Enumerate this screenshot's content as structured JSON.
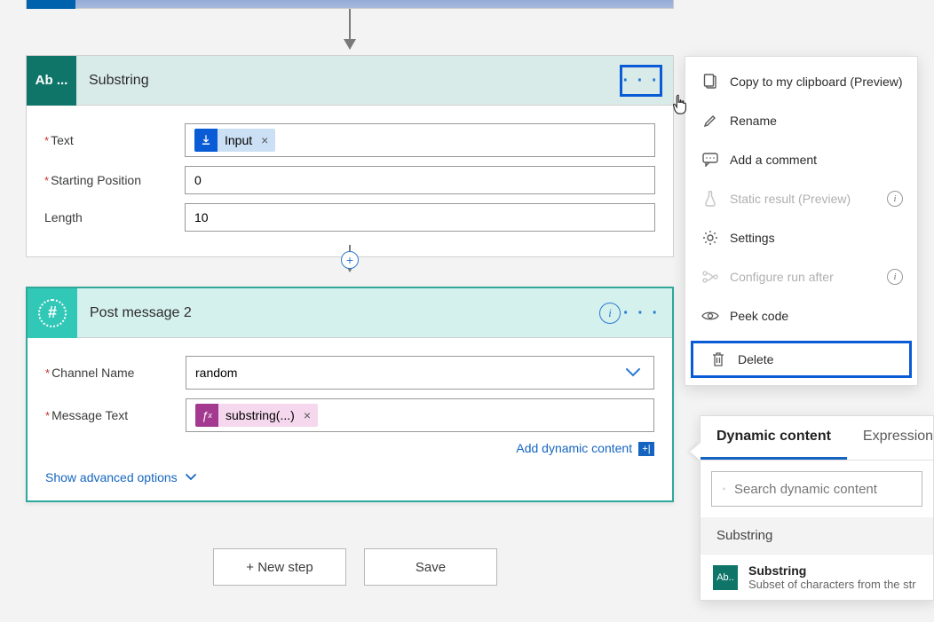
{
  "cards": {
    "substring": {
      "icon_label": "Ab ...",
      "title": "Substring",
      "fields": {
        "text_label": "Text",
        "text_token": "Input",
        "starting_position_label": "Starting Position",
        "starting_position_value": "0",
        "length_label": "Length",
        "length_value": "10"
      }
    },
    "post_message": {
      "title": "Post message 2",
      "fields": {
        "channel_label": "Channel Name",
        "channel_value": "random",
        "message_label": "Message Text",
        "message_token": "substring(...)",
        "add_dynamic_link": "Add dynamic content",
        "show_advanced": "Show advanced options"
      }
    }
  },
  "context_menu": {
    "copy": "Copy to my clipboard (Preview)",
    "rename": "Rename",
    "add_comment": "Add a comment",
    "static_result": "Static result (Preview)",
    "settings": "Settings",
    "configure_run_after": "Configure run after",
    "peek_code": "Peek code",
    "delete": "Delete"
  },
  "dynamic_panel": {
    "tab_dynamic": "Dynamic content",
    "tab_expression": "Expression",
    "search_placeholder": "Search dynamic content",
    "group_title": "Substring",
    "item_title": "Substring",
    "item_sub": "Subset of characters from the str"
  },
  "buttons": {
    "new_step": "+ New step",
    "save": "Save"
  }
}
